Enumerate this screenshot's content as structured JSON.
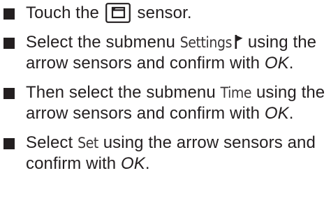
{
  "steps": [
    {
      "pre": "Touch the",
      "icon": "menu-key-icon",
      "post": "sensor."
    },
    {
      "pre": "Select the submenu",
      "menu_item": "Settings",
      "icon": "flag-icon",
      "post": "using the arrow sensors and confirm with",
      "confirm": "OK",
      "end": "."
    },
    {
      "pre": "Then select the submenu",
      "menu_item": "Time",
      "post": "using the arrow sensors and confirm with",
      "confirm": "OK",
      "end": "."
    },
    {
      "pre": "Select",
      "menu_item": "Set",
      "post": "using the arrow sensors and confirm with",
      "confirm": "OK",
      "end": "."
    }
  ],
  "colors": {
    "text": "#231f20",
    "background": "#ffffff"
  }
}
